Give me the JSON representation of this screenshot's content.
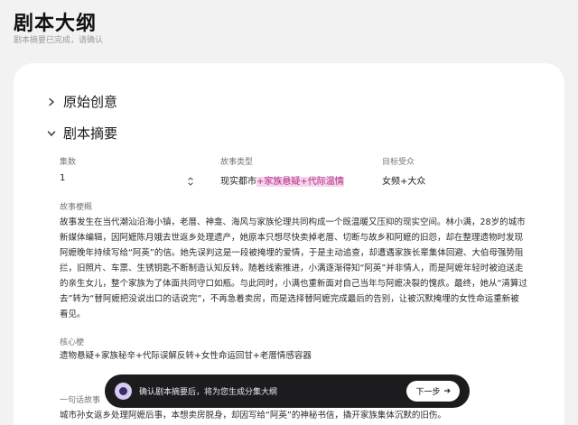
{
  "header": {
    "title": "剧本大纲",
    "subtitle": "剧本摘要已完成，请确认"
  },
  "sections": {
    "original_idea": "原始创意",
    "summary": "剧本摘要"
  },
  "fields": {
    "episodes": {
      "label": "集数",
      "value": "1"
    },
    "story_type": {
      "label": "故事类型",
      "value_plain": "现实都市",
      "value_highlight": "+家族悬疑+代际温情"
    },
    "audience": {
      "label": "目标受众",
      "value": "女频+大众"
    }
  },
  "synopsis": {
    "label": "故事梗概",
    "text": "故事发生在当代潮汕沿海小镇，老厝、神龛、海风与家族伦理共同构成一个既温暖又压抑的现实空间。林小满，28岁的城市新媒体编辑，因阿嬷陈月娥去世返乡处理遗产，她原本只想尽快卖掉老厝、切断与故乡和阿嬷的旧怨，却在整理遗物时发现阿嬷晚年持续写给“阿英”的信。她先误判这是一段被掩埋的爱情，于是主动追查，却遭遇家族长辈集体回避、大伯母强势阻拦，旧照片、车票、生锈钥匙不断制造认知反转。随着线索推进，小满逐渐得知“阿英”并非情人，而是阿嬷年轻时被迫送走的亲生女儿，整个家族为了体面共同守口如瓶。与此同时，小满也重新面对自己当年与阿嬷决裂的愧疚。最终，她从“清算过去”转为“替阿嬷把没说出口的话说完”，不再急着卖房，而是选择替阿嬷完成最后的告别，让被沉默掩埋的女性命运重新被看见。"
  },
  "core": {
    "label": "核心梗",
    "text": "遗物悬疑+家族秘辛+代际误解反转+女性命运回甘+老厝情感容器"
  },
  "oneliner": {
    "label": "一句话故事",
    "text": "城市孙女返乡处理阿嬷后事，本想卖房脱身，却因写给“阿英”的神秘书信，撬开家族集体沉默的旧伤。"
  },
  "toast": {
    "message": "确认剧本摘要后，将为您生成分集大纲",
    "button_label": "下一步",
    "button_arrow": "➔"
  },
  "colors": {
    "highlight_bg": "#f6d4ec",
    "highlight_fg": "#b02f86",
    "toast_bg": "#1c1c1f"
  }
}
